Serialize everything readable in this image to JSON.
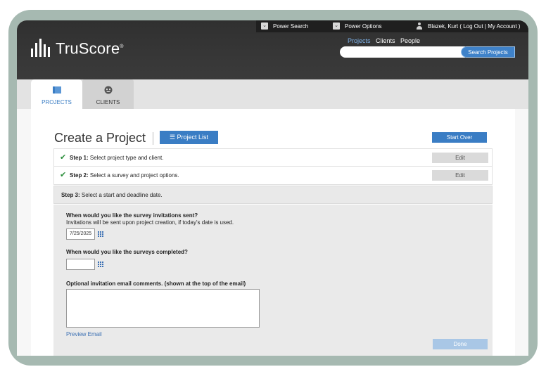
{
  "header": {
    "brand": "TruScore",
    "brand_mark": "®",
    "top_links": {
      "power_search": "Power Search",
      "power_options": "Power Options",
      "user": "Blazek, Kurt ( Log Out | My Account )"
    },
    "nav": [
      "Projects",
      "Clients",
      "People"
    ],
    "search_button": "Search Projects",
    "search_value": ""
  },
  "tabs": [
    {
      "label": "PROJECTS",
      "active": true
    },
    {
      "label": "CLIENTS",
      "active": false
    }
  ],
  "page": {
    "title": "Create a Project",
    "project_list_button": "Project List",
    "start_over_button": "Start Over"
  },
  "steps": [
    {
      "label": "Step 1:",
      "text": "Select project type and client.",
      "edit": "Edit",
      "completed": true
    },
    {
      "label": "Step 2:",
      "text": "Select a survey and project options.",
      "edit": "Edit",
      "completed": true
    },
    {
      "label": "Step 3:",
      "text": "Select a start and deadline date.",
      "completed": false
    }
  ],
  "form": {
    "q1": "When would you like the survey invitations sent?",
    "q1_note": "Invitations will be sent upon project creation, if today's date is used.",
    "q1_value": "7/25/2025",
    "q2": "When would you like the surveys completed?",
    "q2_value": "",
    "q3": "Optional invitation email comments. (shown at the top of the email)",
    "q3_value": "",
    "preview_link": "Preview Email",
    "done_button": "Done"
  },
  "colors": {
    "accent": "#3a7dc4",
    "header_bg": "#333333",
    "frame": "#a6b9b1",
    "check": "#2d8f3d"
  }
}
